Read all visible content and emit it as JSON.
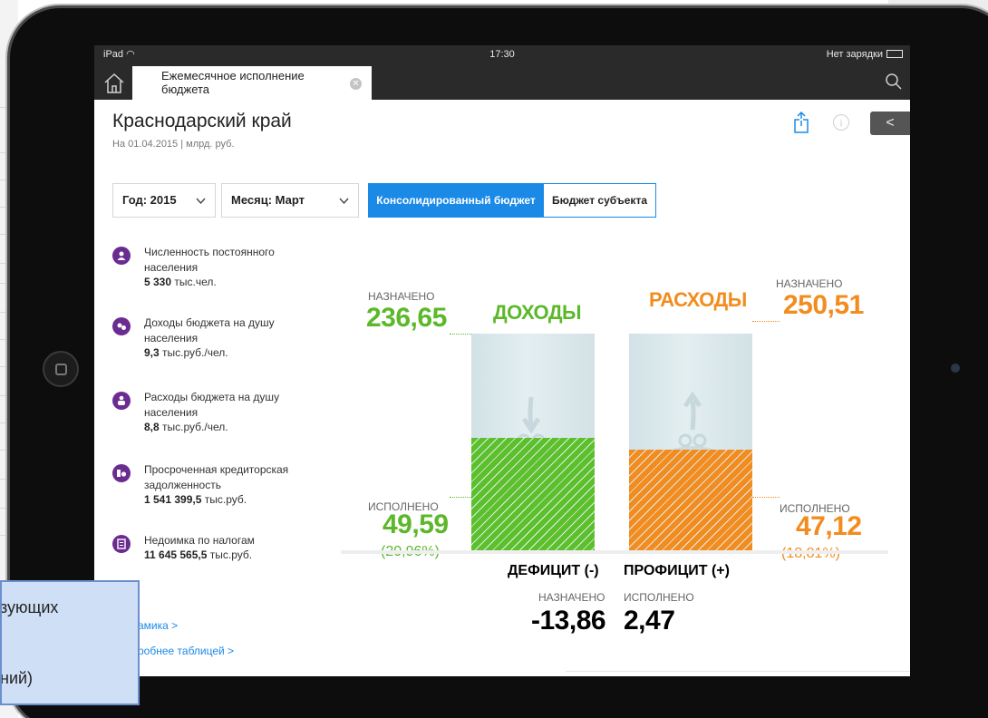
{
  "status_bar": {
    "device": "iPad",
    "time": "17:30",
    "battery": "Нет зарядки"
  },
  "tab": {
    "title_line1": "Ежемесячное исполнение",
    "title_line2": "бюджета"
  },
  "header": {
    "region": "Краснодарский край",
    "subtitle": "На 01.04.2015 | млрд. руб."
  },
  "filters": {
    "year": "Год: 2015",
    "month": "Месяц: Март",
    "budget_types": [
      "Консолидированный бюджет",
      "Бюджет субъекта"
    ],
    "active_budget_type": "Консолидированный бюджет"
  },
  "metrics": [
    {
      "label_lines": [
        "Численность постоянного",
        "населения"
      ],
      "value": "5 330",
      "unit": "тыс.чел.",
      "icon": "population-icon"
    },
    {
      "label_lines": [
        "Доходы бюджета на душу",
        "населения"
      ],
      "value": "9,3",
      "unit": "тыс.руб./чел.",
      "icon": "income-per-capita-icon"
    },
    {
      "label_lines": [
        "Расходы бюджета на душу",
        "населения"
      ],
      "value": "8,8",
      "unit": "тыс.руб./чел.",
      "icon": "expenses-per-capita-icon"
    },
    {
      "label_lines": [
        "Просроченная кредиторская",
        "задолженность"
      ],
      "value": "1 541 399,5",
      "unit": "тыс.руб.",
      "icon": "debt-icon"
    },
    {
      "label_lines": [
        "Недоимка по налогам"
      ],
      "value": "11 645 565,5",
      "unit": "тыс.руб.",
      "icon": "tax-arrears-icon"
    }
  ],
  "links": {
    "dynamics": "амика >",
    "table": "робнее таблицей >"
  },
  "income": {
    "title": "ДОХОДЫ",
    "planned_label": "НАЗНАЧЕНО",
    "planned": "236,65",
    "executed_label": "ИСПОЛНЕНО",
    "executed": "49,59",
    "percent": "(20,96%)",
    "fill_fraction": 0.2096,
    "color": "#5cc02b"
  },
  "expenses": {
    "title": "РАСХОДЫ",
    "planned_label": "НАЗНАЧЕНО",
    "planned": "250,51",
    "executed_label": "ИСПОЛНЕНО",
    "executed": "47,12",
    "percent": "(18,81%)",
    "fill_fraction": 0.1881,
    "color": "#f28c1e"
  },
  "balance": {
    "deficit_title": "ДЕФИЦИТ (-)",
    "deficit_label": "НАЗНАЧЕНО",
    "deficit_value": "-13,86",
    "deficit_color": "#e31e2b",
    "surplus_title": "ПРОФИЦИТ (+)",
    "surplus_label": "ИСПОЛНЕНО",
    "surplus_value": "2,47",
    "surplus_color": "#5cb82a"
  },
  "caption": {
    "line1": "зующих",
    "line2": "ний)"
  }
}
